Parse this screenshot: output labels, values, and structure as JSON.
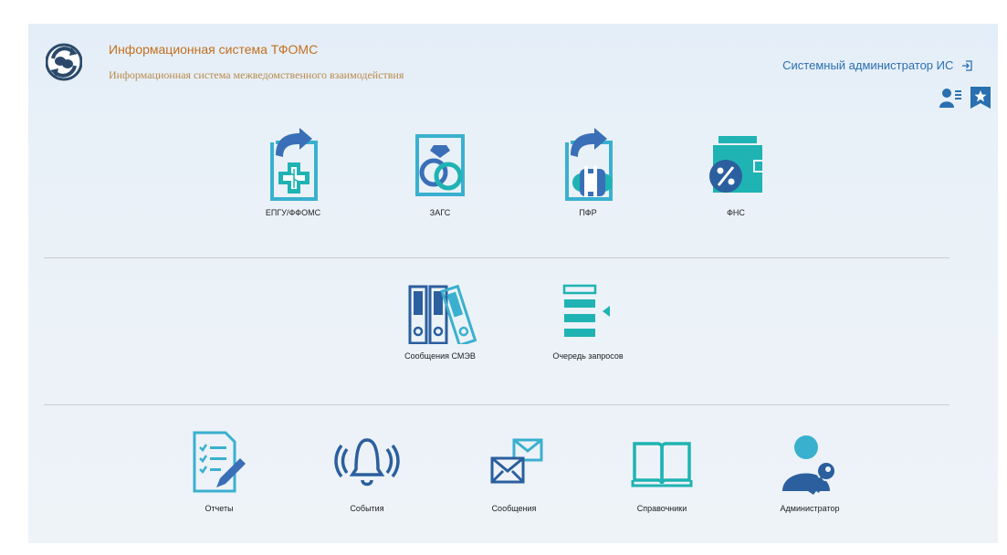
{
  "header": {
    "title": "Информационная система ТФОМС",
    "subtitle": "Информационная система межведомственного взаимодействия",
    "user_label": "Системный администратор ИС",
    "logo_icon": "sync-logo-icon"
  },
  "header_icons": [
    {
      "name": "user-list-icon"
    },
    {
      "name": "bookmark-star-icon"
    }
  ],
  "sections": {
    "services": [
      {
        "label": "ЕПГУ/ФФОМС",
        "icon": "medical-cross-icon"
      },
      {
        "label": "ЗАГС",
        "icon": "rings-icon"
      },
      {
        "label": "ПФР",
        "icon": "pension-fund-icon"
      },
      {
        "label": "ФНС",
        "icon": "tax-percent-icon"
      }
    ],
    "queue": [
      {
        "label": "Сообщения СМЭВ",
        "icon": "binders-icon"
      },
      {
        "label": "Очередь запросов",
        "icon": "queue-list-icon"
      }
    ],
    "tools": [
      {
        "label": "Отчеты",
        "icon": "report-icon"
      },
      {
        "label": "События",
        "icon": "bell-icon"
      },
      {
        "label": "Сообщения",
        "icon": "envelopes-icon"
      },
      {
        "label": "Справочники",
        "icon": "book-icon"
      },
      {
        "label": "Администратор",
        "icon": "admin-key-icon"
      }
    ]
  },
  "colors": {
    "accent_blue": "#2a6fb0",
    "teal": "#1fb3b3",
    "title_orange": "#c2701e"
  }
}
